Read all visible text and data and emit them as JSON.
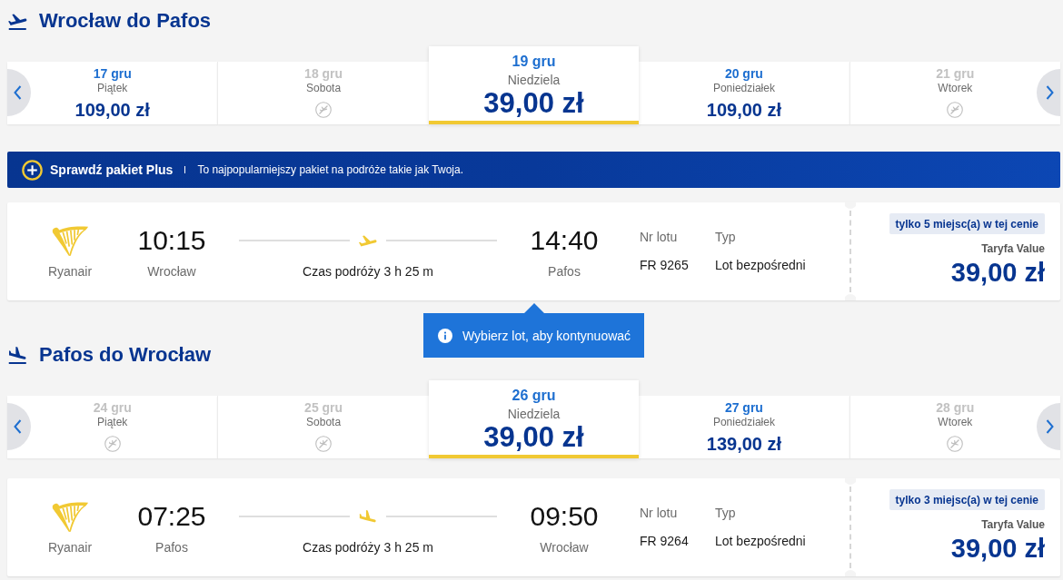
{
  "sections": [
    {
      "kind": "outbound",
      "title": "Wrocław do Pafos",
      "dates": [
        {
          "date": "17 gru",
          "day": "Piątek",
          "price": "109,00 zł",
          "available": true,
          "selected": false
        },
        {
          "date": "18 gru",
          "day": "Sobota",
          "available": false,
          "selected": false
        },
        {
          "date": "19 gru",
          "day": "Niedziela",
          "price": "39,00 zł",
          "available": true,
          "selected": true
        },
        {
          "date": "20 gru",
          "day": "Poniedziałek",
          "price": "109,00 zł",
          "available": true,
          "selected": false
        },
        {
          "date": "21 gru",
          "day": "Wtorek",
          "available": false,
          "selected": false
        }
      ],
      "banner": {
        "title": "Sprawdź pakiet Plus",
        "text": "To najpopularniejszy pakiet na podróże takie jak Twoja."
      },
      "flight": {
        "airline": "Ryanair",
        "departure_time": "10:15",
        "departure_city": "Wrocław",
        "duration": "Czas podróży 3 h 25 m",
        "arrival_time": "14:40",
        "arrival_city": "Pafos",
        "flight_number_label": "Nr lotu",
        "flight_number": "FR 9265",
        "type_label": "Typ",
        "type": "Lot bezpośredni",
        "seats_badge": "tylko 5 miejsc(a) w tej cenie",
        "fare_name": "Taryfa Value",
        "price": "39,00 zł"
      },
      "tooltip": {
        "text": "Wybierz lot, aby kontynuować"
      }
    },
    {
      "kind": "return",
      "title": "Pafos do Wrocław",
      "dates": [
        {
          "date": "24 gru",
          "day": "Piątek",
          "available": false,
          "selected": false
        },
        {
          "date": "25 gru",
          "day": "Sobota",
          "available": false,
          "selected": false
        },
        {
          "date": "26 gru",
          "day": "Niedziela",
          "price": "39,00 zł",
          "available": true,
          "selected": true
        },
        {
          "date": "27 gru",
          "day": "Poniedziałek",
          "price": "139,00 zł",
          "available": true,
          "selected": false
        },
        {
          "date": "28 gru",
          "day": "Wtorek",
          "available": false,
          "selected": false
        }
      ],
      "flight": {
        "airline": "Ryanair",
        "departure_time": "07:25",
        "departure_city": "Pafos",
        "duration": "Czas podróży 3 h 25 m",
        "arrival_time": "09:50",
        "arrival_city": "Wrocław",
        "flight_number_label": "Nr lotu",
        "flight_number": "FR 9264",
        "type_label": "Typ",
        "type": "Lot bezpośredni",
        "seats_badge": "tylko 3 miejsc(a) w tej cenie",
        "fare_name": "Taryfa Value",
        "price": "39,00 zł"
      }
    }
  ]
}
